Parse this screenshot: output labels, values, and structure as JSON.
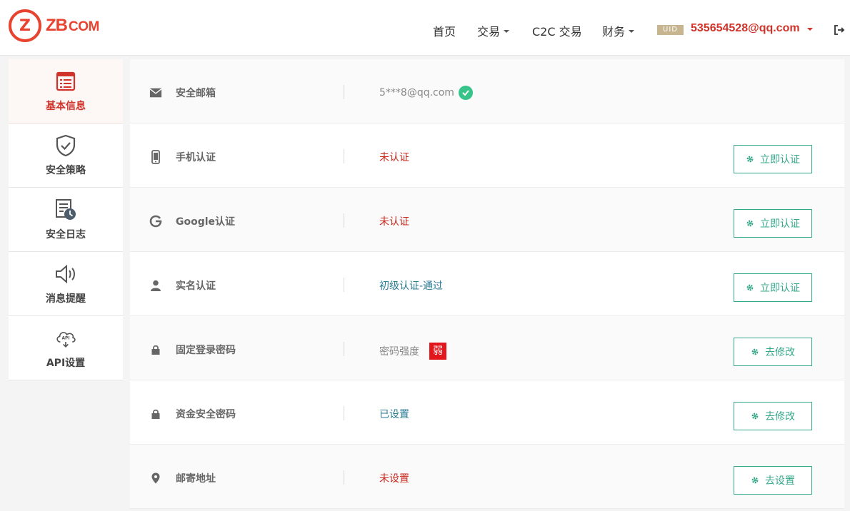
{
  "brand": {
    "mark": "Z",
    "name": "ZB",
    "suffix": "COM"
  },
  "nav": {
    "home": "首页",
    "trade": "交易",
    "c2c": "C2C 交易",
    "finance": "财务",
    "uid_badge": "UID",
    "user_email": "535654528@qq.com"
  },
  "sidebar": {
    "items": [
      {
        "label": "基本信息",
        "icon": "list-icon",
        "active": true
      },
      {
        "label": "安全策略",
        "icon": "shield-check-icon"
      },
      {
        "label": "安全日志",
        "icon": "log-clock-icon"
      },
      {
        "label": "消息提醒",
        "icon": "speaker-icon"
      },
      {
        "label": "API设置",
        "icon": "api-cloud-icon"
      }
    ]
  },
  "rows": [
    {
      "label": "安全邮箱",
      "icon": "envelope-icon",
      "value": "5***8@qq.com",
      "status": "verified"
    },
    {
      "label": "手机认证",
      "icon": "phone-icon",
      "value": "未认证",
      "button": "立即认证"
    },
    {
      "label": "Google认证",
      "icon": "google-icon",
      "value": "未认证",
      "button": "立即认证"
    },
    {
      "label": "实名认证",
      "icon": "user-icon",
      "value": "初级认证-通过",
      "button": "立即认证"
    },
    {
      "label": "固定登录密码",
      "icon": "lock-icon",
      "value": "密码强度",
      "strength": "弱",
      "button": "去修改"
    },
    {
      "label": "资金安全密码",
      "icon": "lock-icon",
      "value": "已设置",
      "button": "去修改"
    },
    {
      "label": "邮寄地址",
      "icon": "location-pin-icon",
      "value": "未设置",
      "button": "去设置"
    }
  ],
  "colors": {
    "brand_red": "#e7432f",
    "accent_green": "#36a88a",
    "status_red": "#c8271c",
    "status_teal": "#2a7b93",
    "weak_red": "#e2161b",
    "check_green": "#38c38a"
  }
}
